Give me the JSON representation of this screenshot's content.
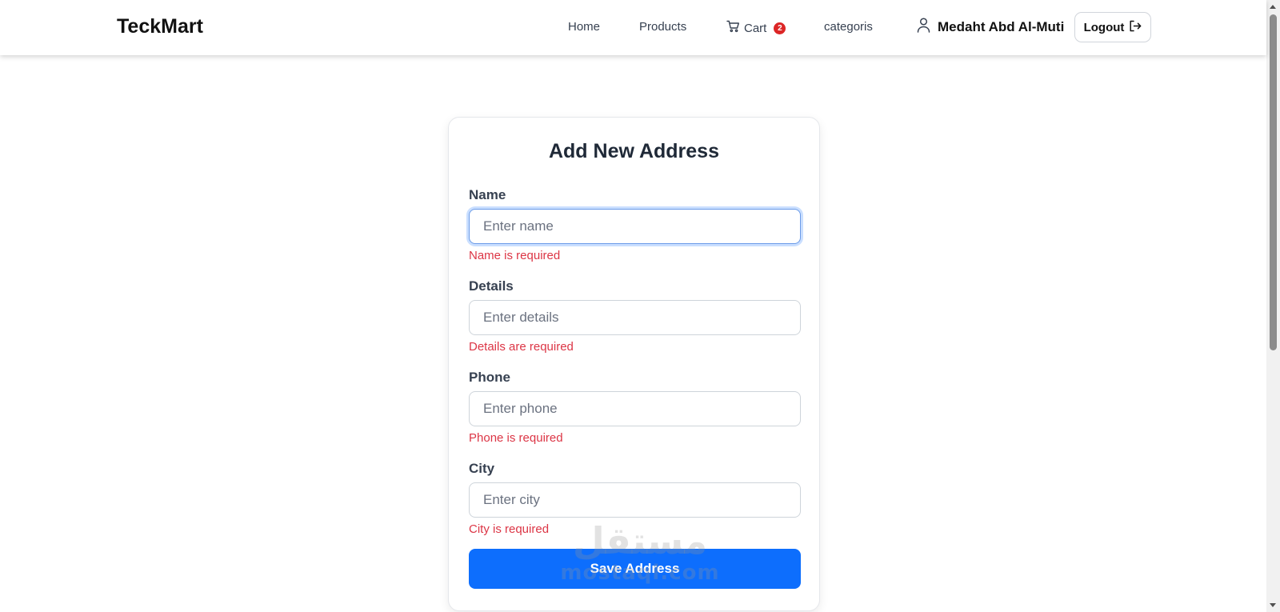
{
  "navbar": {
    "brand": "TeckMart",
    "links": {
      "home": "Home",
      "products": "Products",
      "cart": "Cart",
      "categories": "categoris"
    },
    "cart_count": "2",
    "user_name": "Medaht Abd Al-Muti",
    "logout_label": "Logout",
    "icons": {
      "cart": "cart-icon",
      "user": "user-icon",
      "logout": "logout-icon"
    }
  },
  "form": {
    "title": "Add New Address",
    "fields": {
      "name": {
        "label": "Name",
        "placeholder": "Enter name",
        "value": "",
        "error": "Name is required"
      },
      "details": {
        "label": "Details",
        "placeholder": "Enter details",
        "value": "",
        "error": "Details are required"
      },
      "phone": {
        "label": "Phone",
        "placeholder": "Enter phone",
        "value": "",
        "error": "Phone is required"
      },
      "city": {
        "label": "City",
        "placeholder": "Enter city",
        "value": "",
        "error": "City is required"
      }
    },
    "submit_label": "Save Address"
  },
  "watermark": {
    "arabic": "مستقل",
    "latin": "mostaql.com"
  },
  "colors": {
    "primary": "#0d6efd",
    "error": "#dc3545",
    "badge": "#dc2626",
    "heading": "#1f2937"
  }
}
